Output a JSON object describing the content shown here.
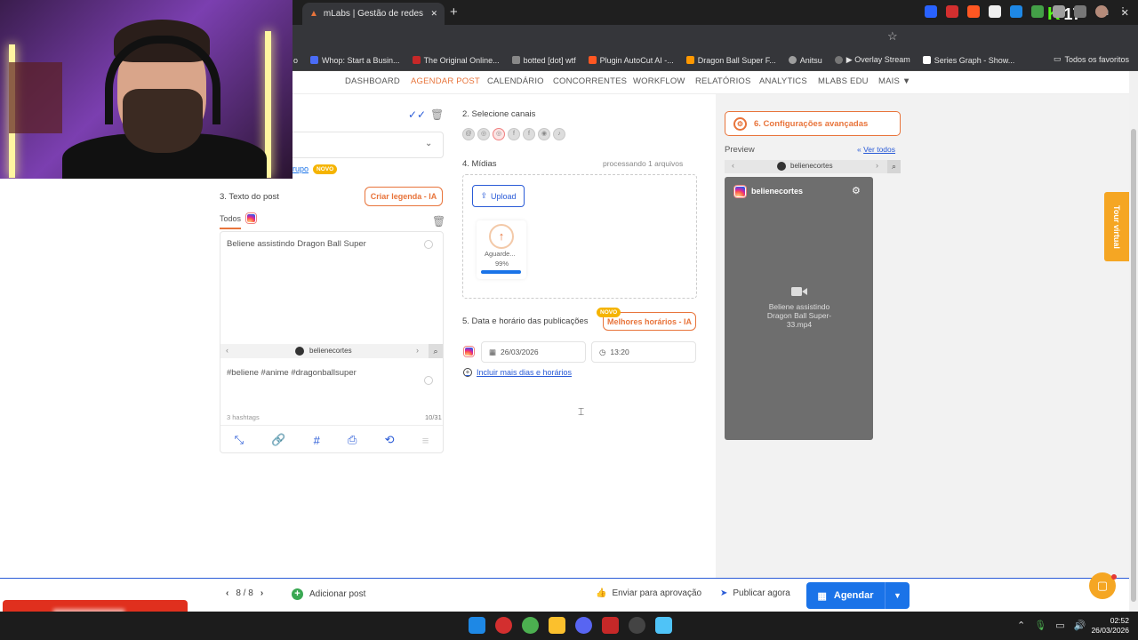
{
  "browser": {
    "tab_title": "mLabs | Gestão de redes sociais",
    "tab_close": "✕",
    "new_tab": "+",
    "kick_count": "17",
    "bookmarks": [
      {
        "label": "Whop: Start a Busin...",
        "color": "#4a6cf7"
      },
      {
        "label": "The Original Online...",
        "color": "#c62828"
      },
      {
        "label": "botted [dot] wtf",
        "color": "#888888"
      },
      {
        "label": "Plugin AutoCut AI -...",
        "color": "#ff5722"
      },
      {
        "label": "Dragon Ball Super F...",
        "color": "#ff9800"
      },
      {
        "label": "Anitsu",
        "color": "#9e9e9e"
      },
      {
        "label": "▶ Overlay Stream",
        "color": "#777777"
      },
      {
        "label": "Series Graph - Show...",
        "color": "#ffffff"
      }
    ],
    "bookmarks_all": "Todos os favoritos",
    "partial_bm_text": "o"
  },
  "nav": {
    "items": [
      {
        "label": "DASHBOARD",
        "active": false
      },
      {
        "label": "AGENDAR POST",
        "active": true
      },
      {
        "label": "CALENDÁRIO",
        "active": false
      },
      {
        "label": "CONCORRENTES",
        "active": false
      },
      {
        "label": "WORKFLOW",
        "active": false
      },
      {
        "label": "RELATÓRIOS",
        "active": false
      },
      {
        "label": "ANALYTICS",
        "active": false
      },
      {
        "label": "MLABS EDU",
        "active": false
      },
      {
        "label": "MAIS ▼",
        "active": false
      }
    ]
  },
  "left": {
    "grupo_link": "rupo",
    "novo_badge": "NOVO",
    "section3_title": "3. Texto do post",
    "criar_legenda": "Criar legenda - IA",
    "todos_tab": "Todos",
    "post_text": "Beliene assistindo Dragon Ball Super",
    "account_name": "belienecortes",
    "hashtags_text": "#beliene #anime #dragonballsuper",
    "hashtag_count": "3 hashtags",
    "char_count": "10/31"
  },
  "middle": {
    "section2_title": "2. Selecione canais",
    "section4_title": "4. Mídias",
    "processing": "processando 1 arquivos",
    "upload_label": "Upload",
    "upload_status": "Aguarde...",
    "upload_percent": "99%",
    "upload_progress": 0.99,
    "section5_title": "5. Data e horário das publicações",
    "melhores_horarios": "Melhores horários - IA",
    "novo_badge": "NOVO",
    "date_value": "26/03/2026",
    "time_value": "13:20",
    "incluir_mais": "Incluir mais dias e horários"
  },
  "right": {
    "advanced_settings": "6. Configurações avançadas",
    "preview_label": "Preview",
    "ver_todos": "Ver todos",
    "account_name": "belienecortes",
    "preview_file": "Beliene assistindo Dragon Ball Super-33.mp4",
    "tour_label": "Tour virtual"
  },
  "bottom": {
    "pager": "8 / 8",
    "add_post": "Adicionar post",
    "send_approval": "Enviar para aprovação",
    "publish_now": "Publicar agora",
    "schedule": "Agendar"
  },
  "taskbar": {
    "time": "02:52",
    "date": "26/03/2026"
  },
  "colors": {
    "accent_orange": "#e8743b",
    "primary_blue": "#1a73e8",
    "novo_yellow": "#f5b400",
    "preview_bg": "#6e6e6e"
  }
}
